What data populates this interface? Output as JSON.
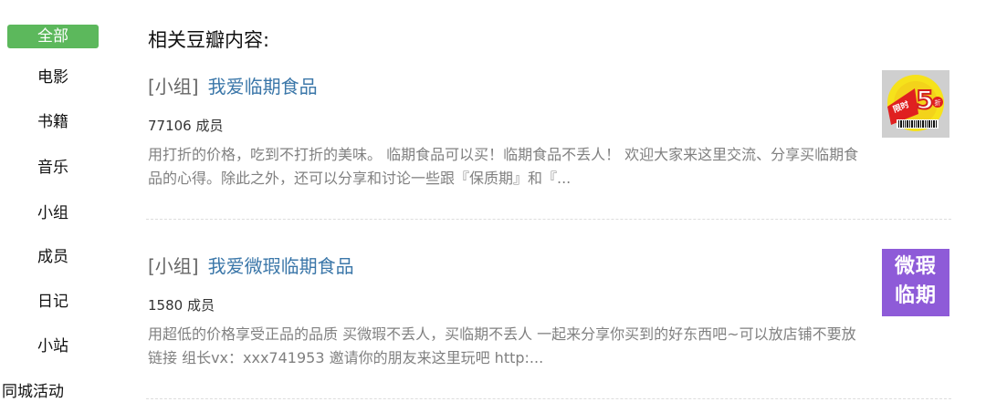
{
  "nav": {
    "items": [
      {
        "label": "全部",
        "active": true
      },
      {
        "label": "电影",
        "active": false
      },
      {
        "label": "书籍",
        "active": false
      },
      {
        "label": "音乐",
        "active": false
      },
      {
        "label": "小组",
        "active": false
      },
      {
        "label": "成员",
        "active": false
      },
      {
        "label": "日记",
        "active": false
      },
      {
        "label": "小站",
        "active": false
      },
      {
        "label": "同城活动",
        "active": false
      }
    ],
    "accent_color": "#5cb85c"
  },
  "main": {
    "section_title": "相关豆瓣内容:",
    "results": [
      {
        "tag": "[小组]",
        "title": "我爱临期食品",
        "members": "77106 成员",
        "description": "用打折的价格，吃到不打折的美味。 临期食品可以买！临期食品不丢人！ 欢迎大家来这里交流、分享买临期食品的心得。除此之外，还可以分享和讨论一些跟『保质期』和『...",
        "thumbnail": {
          "type": "sticker",
          "sticker_text": "限时",
          "sticker_number": "5",
          "sticker_suffix": "折"
        }
      },
      {
        "tag": "[小组]",
        "title": "我爱微瑕临期食品",
        "members": "1580 成员",
        "description": "用超低的价格享受正品的品质 买微瑕不丢人，买临期不丢人 一起来分享你买到的好东西吧~可以放店铺不要放链接 组长vx：xxx741953 邀请你的朋友来这里玩吧 http:...",
        "thumbnail": {
          "type": "label",
          "line1": "微瑕",
          "line2": "临期",
          "color": "#8e5bd8"
        }
      }
    ],
    "link_color": "#3b77a9"
  }
}
